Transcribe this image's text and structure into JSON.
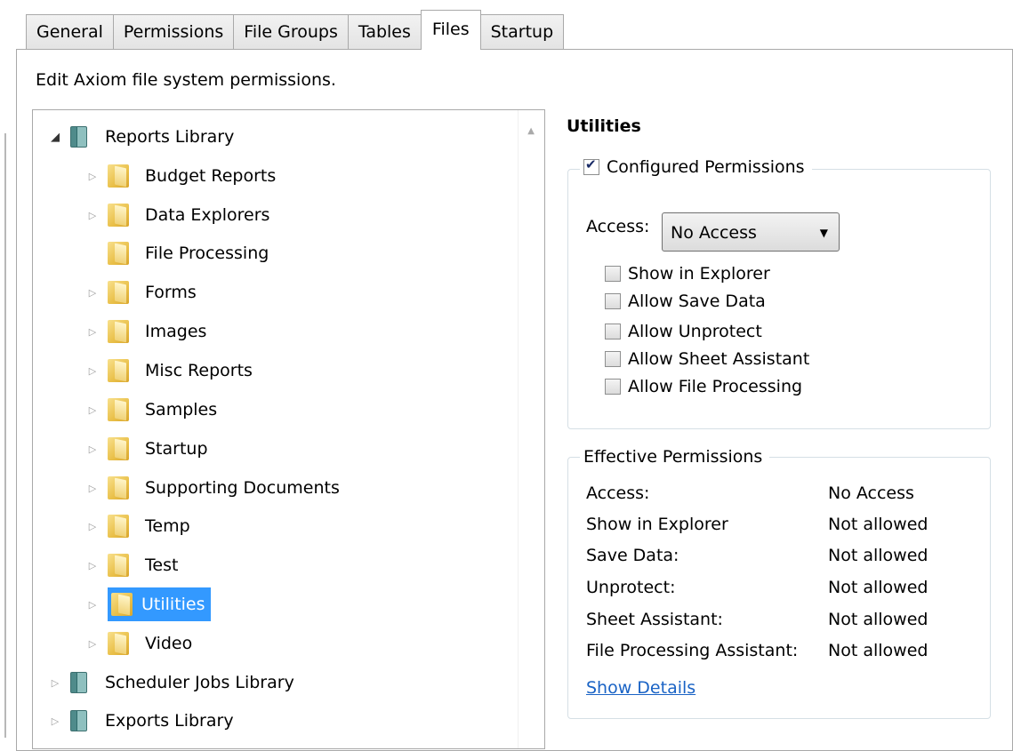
{
  "tabs": [
    {
      "label": "General"
    },
    {
      "label": "Permissions"
    },
    {
      "label": "File Groups"
    },
    {
      "label": "Tables"
    },
    {
      "label": "Files",
      "active": true
    },
    {
      "label": "Startup"
    }
  ],
  "description": "Edit Axiom file system permissions.",
  "tree": {
    "root": "Reports Library",
    "folders": [
      "Budget Reports",
      "Data Explorers",
      "File Processing",
      "Forms",
      "Images",
      "Misc Reports",
      "Samples",
      "Startup",
      "Supporting Documents",
      "Temp",
      "Test",
      "Utilities",
      "Video"
    ],
    "libraries": [
      "Scheduler Jobs Library",
      "Exports Library"
    ],
    "selected": "Utilities"
  },
  "details": {
    "title": "Utilities",
    "configured": {
      "label": "Configured Permissions",
      "checked": true,
      "access_label": "Access:",
      "access_value": "No Access",
      "options": [
        "Show in Explorer",
        "Allow Save Data",
        "Allow Unprotect",
        "Allow Sheet Assistant",
        "Allow File Processing"
      ]
    },
    "effective": {
      "label": "Effective Permissions",
      "rows": [
        {
          "k": "Access:",
          "v": "No Access"
        },
        {
          "k": "Show in Explorer",
          "v": "Not allowed"
        },
        {
          "k": "Save Data:",
          "v": "Not allowed"
        },
        {
          "k": "Unprotect:",
          "v": "Not allowed"
        },
        {
          "k": "Sheet Assistant:",
          "v": "Not allowed"
        },
        {
          "k": "File Processing Assistant:",
          "v": "Not allowed"
        }
      ],
      "show_details": "Show Details"
    }
  },
  "colors": {
    "selection": "#3399ff",
    "link": "#1a63c5"
  }
}
